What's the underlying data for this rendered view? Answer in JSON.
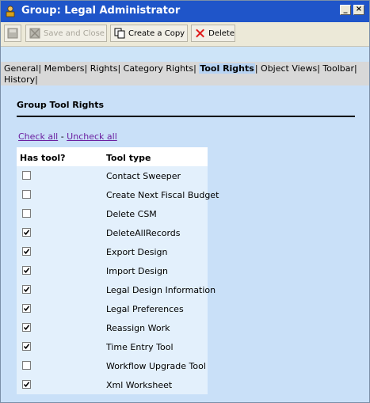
{
  "window": {
    "title": "Group: Legal Administrator",
    "titlebar_color": "#1f55c9",
    "minimize_glyph": "_",
    "close_glyph": "×"
  },
  "toolbar": {
    "save_close_label": "Save and Close",
    "create_copy_label": "Create a Copy",
    "delete_label": "Delete"
  },
  "tabs": [
    {
      "label": "General"
    },
    {
      "label": "Members"
    },
    {
      "label": "Rights"
    },
    {
      "label": "Category Rights"
    },
    {
      "label": "Tool Rights"
    },
    {
      "label": "Object Views"
    },
    {
      "label": "Toolbar"
    },
    {
      "label": "History"
    }
  ],
  "active_tab": "Tool Rights",
  "section": {
    "title": "Group Tool Rights",
    "check_all_label": "Check all",
    "link_separator": "-",
    "uncheck_all_label": "Uncheck all"
  },
  "table": {
    "headers": {
      "has_tool": "Has tool?",
      "tool_type": "Tool type"
    },
    "rows": [
      {
        "tool": "Contact Sweeper",
        "checked": false
      },
      {
        "tool": "Create Next Fiscal Budget",
        "checked": false
      },
      {
        "tool": "Delete CSM",
        "checked": false
      },
      {
        "tool": "DeleteAllRecords",
        "checked": true
      },
      {
        "tool": "Export Design",
        "checked": true
      },
      {
        "tool": "Import Design",
        "checked": true
      },
      {
        "tool": "Legal Design Information",
        "checked": true
      },
      {
        "tool": "Legal Preferences",
        "checked": true
      },
      {
        "tool": "Reassign Work",
        "checked": true
      },
      {
        "tool": "Time Entry Tool",
        "checked": true
      },
      {
        "tool": "Workflow Upgrade Tool",
        "checked": false
      },
      {
        "tool": "Xml Worksheet",
        "checked": true
      }
    ]
  }
}
